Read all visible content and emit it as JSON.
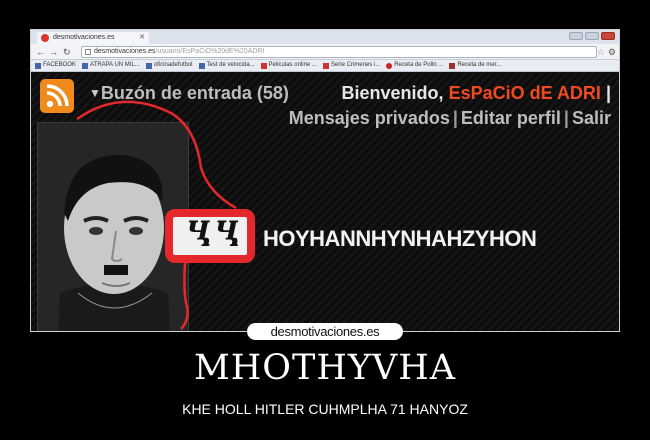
{
  "browser": {
    "tab_title": "desmotivaciones.es",
    "url_host": "desmotivaciones.es",
    "url_path": "/usuario/EsPaCiO%20dE%20ADRI",
    "bookmarks": [
      {
        "label": "FACEBOOK",
        "icon": "facebook-icon"
      },
      {
        "label": "ATRAPA UN MIL...",
        "icon": "bookmark-icon"
      },
      {
        "label": "oficinadefutbol",
        "icon": "bookmark-icon"
      },
      {
        "label": "Test de velocida...",
        "icon": "bookmark-icon"
      },
      {
        "label": "Peliculas online ...",
        "icon": "bookmark-icon"
      },
      {
        "label": "Serie Crimenes i...",
        "icon": "bookmark-icon"
      },
      {
        "label": "Receta de Pollo ...",
        "icon": "bookmark-icon"
      },
      {
        "label": "Receta de mer...",
        "icon": "bookmark-icon"
      }
    ]
  },
  "header": {
    "inbox_label": "Buzón de entrada (58)",
    "welcome_prefix": "Bienvenido,",
    "username": "EsPaCiO dE ADRI",
    "private_messages": "Mensajes privados",
    "edit_profile": "Editar perfil",
    "logout": "Salir",
    "separator": "|"
  },
  "profile": {
    "nickname": "HOYHANNHYNHAHZYHON",
    "box_glyph": "ႡႡ"
  },
  "poster": {
    "watermark": "desmotivaciones.es",
    "title": "MHOTHYVHA",
    "subtitle": "KHE HOLL HITLER CUHMPLHA 71 HANYOZ"
  },
  "colors": {
    "username": "#f14a22",
    "rss": "#f08a1c",
    "scribble": "#e5282b"
  }
}
